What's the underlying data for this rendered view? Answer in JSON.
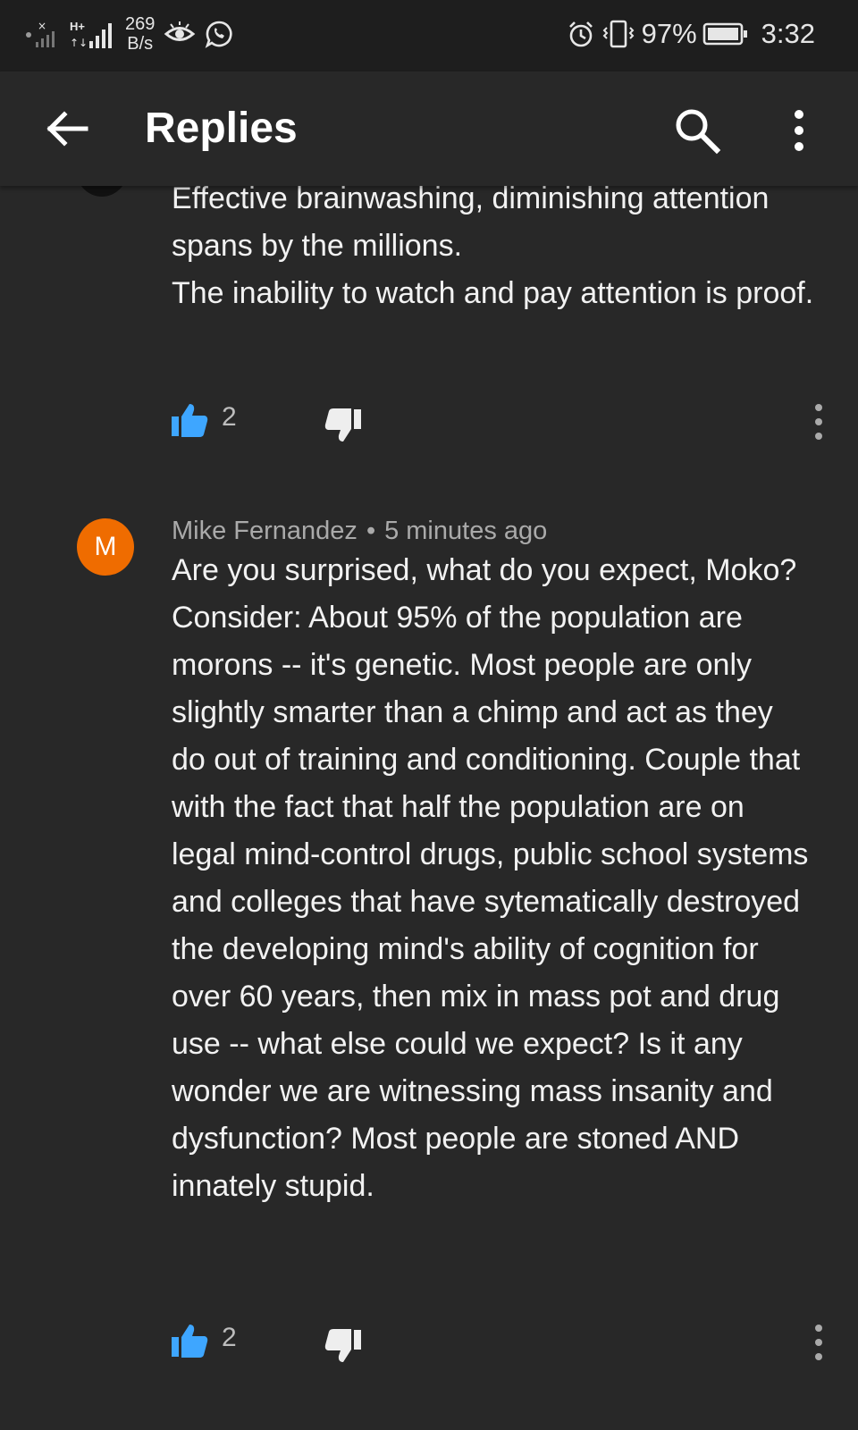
{
  "status_bar": {
    "network_type": "H+",
    "net_speed_value": "269",
    "net_speed_unit": "B/s",
    "battery": "97%",
    "time": "3:32"
  },
  "app_bar": {
    "title": "Replies"
  },
  "comments": [
    {
      "text": "Effective brainwashing, diminishing attention spans by the millions.\nThe inability to watch and pay attention is proof.",
      "likes": "2"
    },
    {
      "avatar_letter": "M",
      "avatar_color": "#ef6c00",
      "author": "Mike Fernandez",
      "time": "5 minutes ago",
      "text": "Are you surprised, what do you expect, Moko?  Consider:  About 95% of the population are morons -- it's genetic.  Most people are only slightly smarter than a chimp and act as they do out of training and conditioning.  Couple that with the fact that half the population are on legal mind-control drugs, public school systems and colleges that have sytematically destroyed the developing mind's ability of cognition for over 60 years, then mix in mass pot and drug use -- what else could we expect?  Is it any wonder we are witnessing mass insanity and dysfunction?  Most people are stoned AND innately stupid.",
      "likes": "2"
    }
  ],
  "colors": {
    "background": "#282828",
    "status_bar": "#1e1e1e",
    "like_active": "#3ea6ff",
    "secondary_text": "#aaaaaa"
  }
}
